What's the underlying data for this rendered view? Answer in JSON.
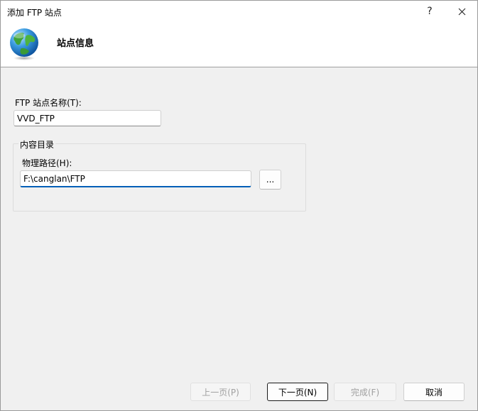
{
  "window": {
    "title": "添加 FTP 站点",
    "help_label": "?",
    "close_label": "✕"
  },
  "header": {
    "title": "站点信息",
    "icon": "globe-icon"
  },
  "form": {
    "site_name_label": "FTP 站点名称(T):",
    "site_name_value": "VVD_FTP",
    "content_group_label": "内容目录",
    "physical_path_label": "物理路径(H):",
    "physical_path_value": "F:\\canglan\\FTP",
    "browse_label": "..."
  },
  "footer": {
    "prev_label": "上一页(P)",
    "next_label": "下一页(N)",
    "finish_label": "完成(F)",
    "cancel_label": "取消"
  },
  "colors": {
    "accent": "#005fb8",
    "dialog_bg": "#f0f0f0"
  }
}
